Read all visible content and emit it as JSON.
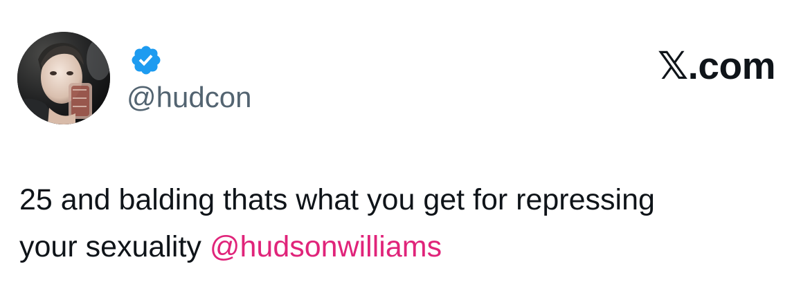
{
  "author": {
    "handle": "@hudcon",
    "verified": true,
    "verified_color": "#1d9bf0"
  },
  "brand": {
    "label": "𝕏.com"
  },
  "tweet": {
    "line1": "25 and balding thats what you get for repressing",
    "line2_text": "your sexuality ",
    "mention": "@hudsonwilliams",
    "mention_color": "#e0247a"
  },
  "icons": {
    "avatar": "profile-photo",
    "badge": "verified-badge-icon"
  }
}
